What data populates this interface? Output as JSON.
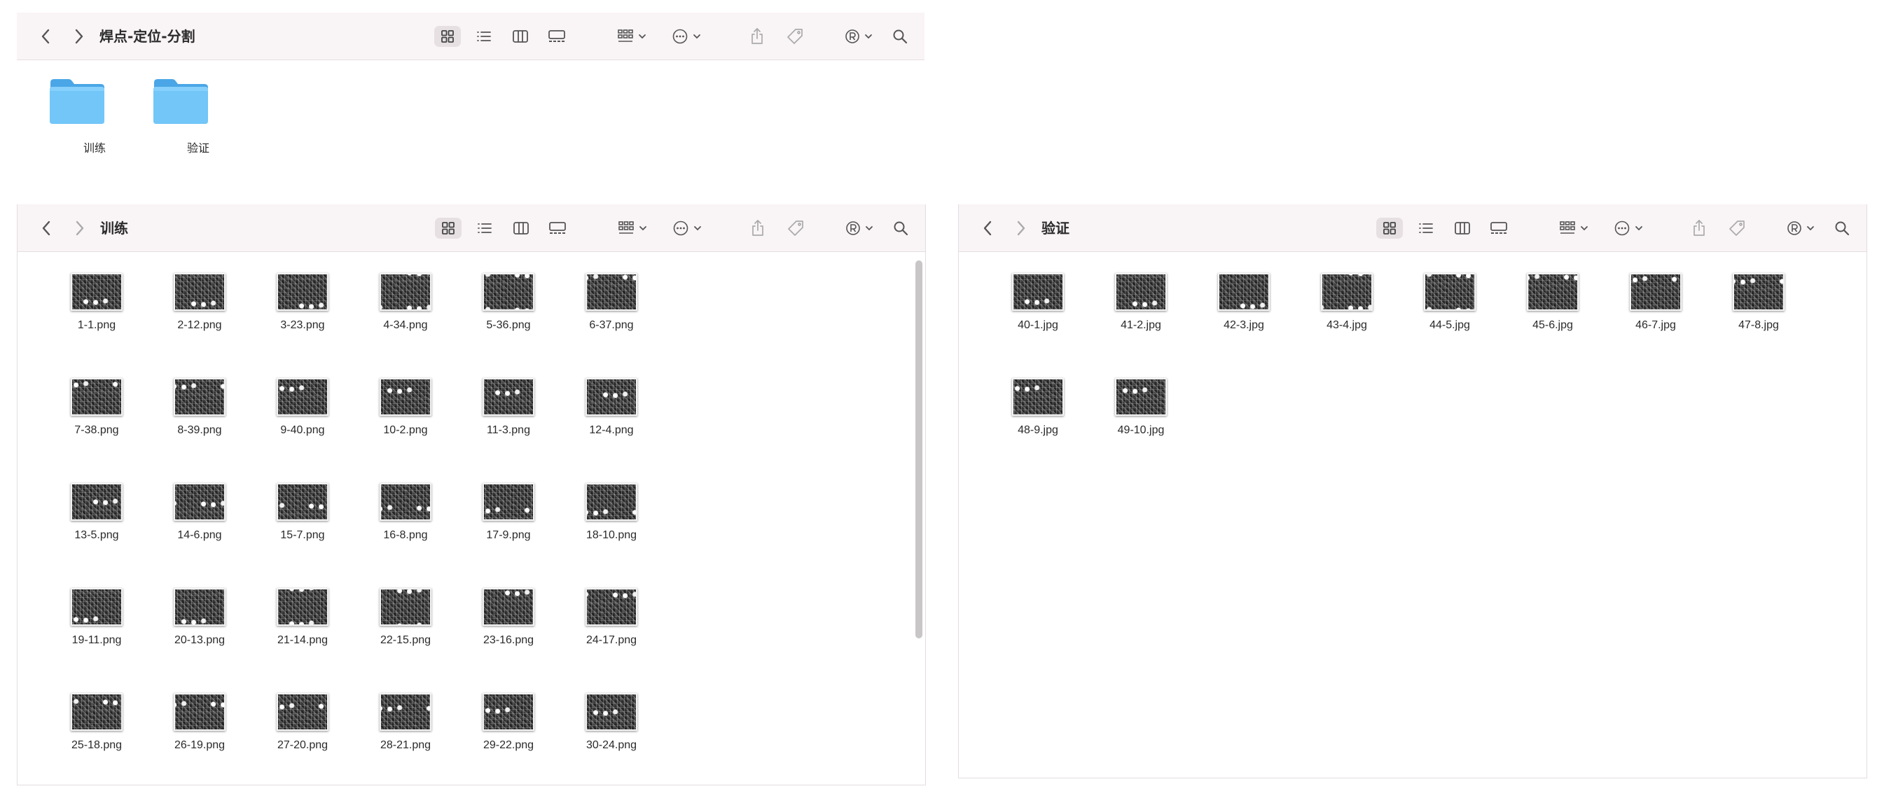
{
  "top_window": {
    "title": "焊点-定位-分割",
    "folders": [
      {
        "label": "训练",
        "icon": "folder-icon"
      },
      {
        "label": "验证",
        "icon": "folder-icon"
      }
    ]
  },
  "train_window": {
    "title": "训练",
    "files": [
      "1-1.png",
      "2-12.png",
      "3-23.png",
      "4-34.png",
      "5-36.png",
      "6-37.png",
      "7-38.png",
      "8-39.png",
      "9-40.png",
      "10-2.png",
      "11-3.png",
      "12-4.png",
      "13-5.png",
      "14-6.png",
      "15-7.png",
      "16-8.png",
      "17-9.png",
      "18-10.png",
      "19-11.png",
      "20-13.png",
      "21-14.png",
      "22-15.png",
      "23-16.png",
      "24-17.png",
      "25-18.png",
      "26-19.png",
      "27-20.png",
      "28-21.png",
      "29-22.png",
      "30-24.png"
    ]
  },
  "val_window": {
    "title": "验证",
    "files": [
      "40-1.jpg",
      "41-2.jpg",
      "42-3.jpg",
      "43-4.jpg",
      "44-5.jpg",
      "45-6.jpg",
      "46-7.jpg",
      "47-8.jpg",
      "48-9.jpg",
      "49-10.jpg"
    ]
  },
  "toolbar_icons": [
    "back-icon",
    "forward-icon",
    "icon-view-icon",
    "list-view-icon",
    "column-view-icon",
    "gallery-view-icon",
    "group-icon",
    "more-icon",
    "share-icon",
    "tag-icon",
    "account-icon",
    "search-icon"
  ],
  "colors": {
    "toolbar_bg": "#f9f4f6",
    "folder_blue": "#5bb8f2",
    "selected_view": "#e6e0e3"
  }
}
